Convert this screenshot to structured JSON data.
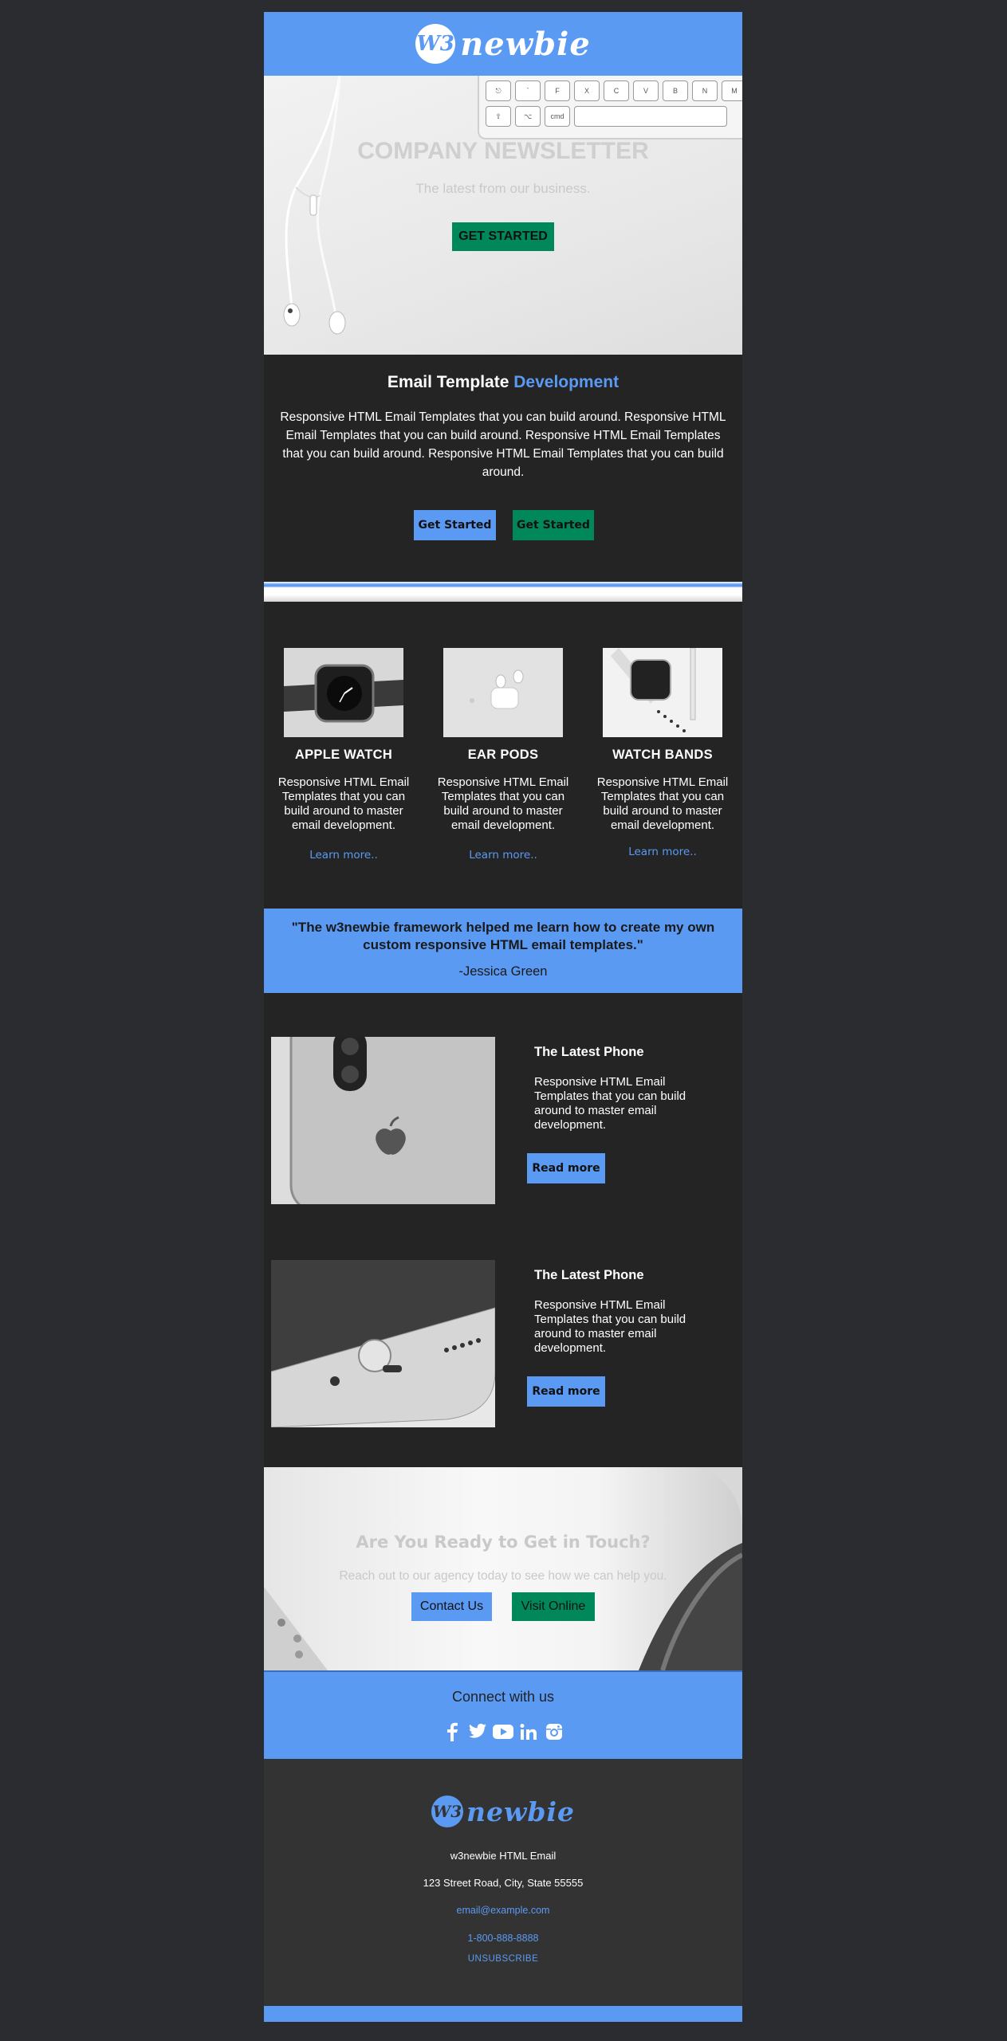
{
  "header": {
    "logo_badge": "W3",
    "logo_text": "newbie"
  },
  "hero": {
    "keys_row1": [
      "⎋",
      "`",
      "F",
      "X",
      "C",
      "V",
      "B",
      "N",
      "M",
      "<"
    ],
    "keys_row2": [
      "⇧",
      "⌥",
      "cmd"
    ],
    "title": "COMPANY NEWSLETTER",
    "subtitle": "The latest from our business.",
    "button": "GET STARTED"
  },
  "intro": {
    "title_plain": "Email Template",
    "title_accent": "Development",
    "body": "Responsive HTML Email Templates that you can build around. Responsive HTML Email Templates that you can build around. Responsive HTML Email Templates that you can build around. Responsive HTML Email Templates that you can build around.",
    "button1": "Get Started",
    "button2": "Get Started"
  },
  "products": [
    {
      "title": "APPLE WATCH",
      "body": "Responsive HTML Email Templates that you can build around to master email development.",
      "link": "Learn more.."
    },
    {
      "title": "EAR PODS",
      "body": "Responsive HTML Email Templates that you can build around to master email development.",
      "link": "Learn more.."
    },
    {
      "title": "WATCH BANDS",
      "body": "Responsive HTML Email Templates that you can build around to master email development.",
      "link": "Learn more.."
    }
  ],
  "quote": {
    "text": "\"The w3newbie framework helped me learn how to create my own custom responsive HTML email templates.\"",
    "author": "-Jessica Green"
  },
  "features": [
    {
      "title": "The Latest Phone",
      "body": "Responsive HTML Email Templates that you can build around to master email development.",
      "button": "Read more"
    },
    {
      "title": "The Latest Phone",
      "body": "Responsive HTML Email Templates that you can build around to master email development.",
      "button": "Read more"
    }
  ],
  "contact": {
    "title": "Are You Ready to Get in Touch?",
    "body": "Reach out to our agency today to see how we can help you.",
    "button1": "Contact Us",
    "button2": "Visit Online"
  },
  "social": {
    "title": "Connect with us",
    "icons": [
      "facebook-icon",
      "twitter-icon",
      "youtube-icon",
      "linkedin-icon",
      "instagram-icon"
    ]
  },
  "footer": {
    "logo_badge": "W3",
    "logo_text": "newbie",
    "company": "w3newbie HTML Email",
    "address": "123 Street Road, City, State 55555",
    "email": "email@example.com",
    "phone": "1-800-888-8888",
    "unsubscribe": "UNSUBSCRIBE"
  },
  "colors": {
    "accent": "#5b9af3",
    "green": "#00875a",
    "dark": "#242424",
    "background": "#2b2c30"
  }
}
